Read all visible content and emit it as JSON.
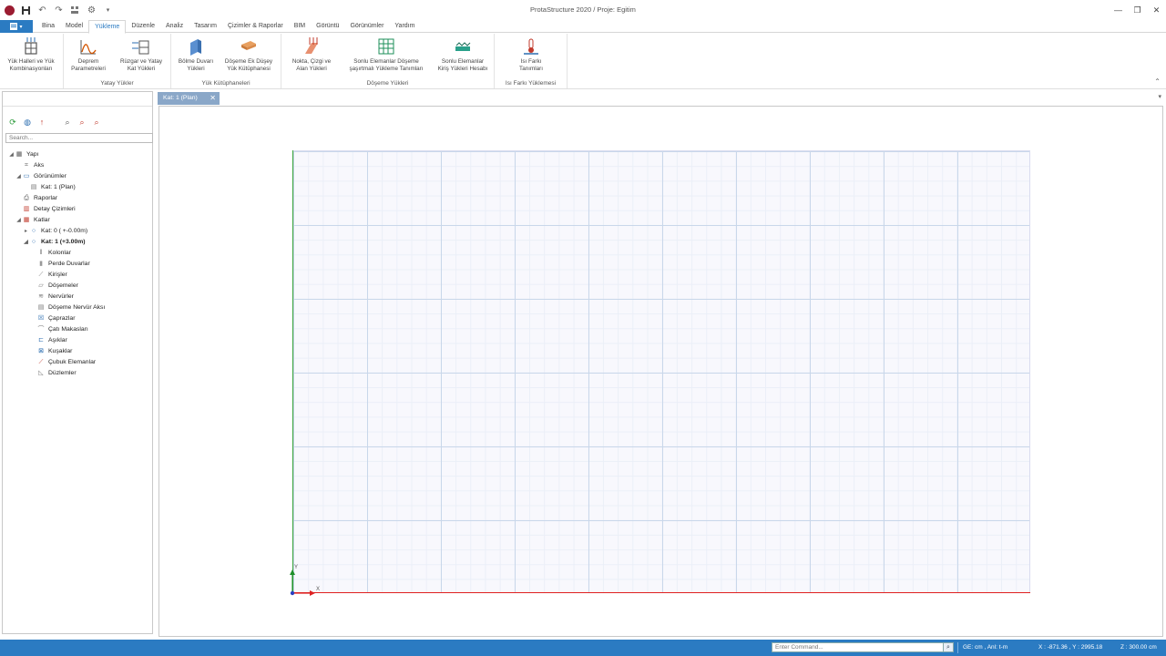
{
  "window": {
    "title": "ProtaStructure 2020 / Proje: Egitim"
  },
  "tabs": [
    {
      "label": "Bina",
      "active": false
    },
    {
      "label": "Model",
      "active": false
    },
    {
      "label": "Yükleme",
      "active": true
    },
    {
      "label": "Düzenle",
      "active": false
    },
    {
      "label": "Analiz",
      "active": false
    },
    {
      "label": "Tasarım",
      "active": false
    },
    {
      "label": "Çizimler & Raporlar",
      "active": false
    },
    {
      "label": "BIM",
      "active": false
    },
    {
      "label": "Görüntü",
      "active": false
    },
    {
      "label": "Görünümler",
      "active": false
    },
    {
      "label": "Yardım",
      "active": false
    }
  ],
  "ribbon": {
    "groups": [
      {
        "title": "",
        "buttons": [
          {
            "line1": "Yük Halleri ve Yük",
            "line2": "Kombinasyonları",
            "icon": "load-cases-icon"
          }
        ]
      },
      {
        "title": "Yatay Yükler",
        "buttons": [
          {
            "line1": "Deprem",
            "line2": "Parametreleri",
            "icon": "seismic-icon"
          },
          {
            "line1": "Rüzgar ve Yatay",
            "line2": "Kat Yükleri",
            "icon": "wind-icon"
          }
        ]
      },
      {
        "title": "Yük Kütüphaneleri",
        "buttons": [
          {
            "line1": "Bölme Duvarı",
            "line2": "Yükleri",
            "icon": "partition-wall-icon"
          },
          {
            "line1": "Döşeme Ek Düşey",
            "line2": "Yük Kütüphanesi",
            "icon": "slab-library-icon"
          }
        ]
      },
      {
        "title": "Döşeme Yükleri",
        "buttons": [
          {
            "line1": "Nokta, Çizgi ve",
            "line2": "Alan Yükleri",
            "icon": "point-line-area-icon"
          },
          {
            "line1": "Sonlu Elemanlar Döşeme",
            "line2": "şaşırtmalı Yükleme Tanımları",
            "icon": "fe-slab-icon"
          },
          {
            "line1": "Sonlu Elemanlar",
            "line2": "Kiriş Yükleri Hesabı",
            "icon": "fe-beam-icon"
          }
        ]
      },
      {
        "title": "Isı Farkı Yüklemesi",
        "buttons": [
          {
            "line1": "Isı Farkı",
            "line2": "Tanımları",
            "icon": "temperature-icon"
          }
        ]
      }
    ]
  },
  "left_panel": {
    "search_placeholder": "Search...",
    "tree": [
      {
        "label": "Yapı",
        "level": 0,
        "exp": "◢",
        "icon": "building-icon",
        "bold": false
      },
      {
        "label": "Aks",
        "level": 1,
        "exp": "",
        "icon": "axis-icon",
        "bold": false
      },
      {
        "label": "Görünümler",
        "level": 1,
        "exp": "◢",
        "icon": "views-icon",
        "bold": false
      },
      {
        "label": "Kat: 1 (Plan)",
        "level": 2,
        "exp": "",
        "icon": "plan-view-icon",
        "bold": false
      },
      {
        "label": "Raporlar",
        "level": 1,
        "exp": "",
        "icon": "printer-icon",
        "bold": false
      },
      {
        "label": "Detay Çizimleri",
        "level": 1,
        "exp": "",
        "icon": "drawings-icon",
        "bold": false
      },
      {
        "label": "Katlar",
        "level": 1,
        "exp": "◢",
        "icon": "storeys-icon",
        "bold": false
      },
      {
        "label": "Kat: 0 ( +-0.00m)",
        "level": 2,
        "exp": "▸",
        "icon": "storey-icon",
        "bold": false
      },
      {
        "label": "Kat: 1 (+3.00m)",
        "level": 2,
        "exp": "◢",
        "icon": "storey-icon",
        "bold": true
      },
      {
        "label": "Kolonlar",
        "level": 3,
        "exp": "",
        "icon": "column-icon",
        "bold": false
      },
      {
        "label": "Perde Duvarlar",
        "level": 3,
        "exp": "",
        "icon": "shear-wall-icon",
        "bold": false
      },
      {
        "label": "Kirişler",
        "level": 3,
        "exp": "",
        "icon": "beam-icon",
        "bold": false
      },
      {
        "label": "Döşemeler",
        "level": 3,
        "exp": "",
        "icon": "slab-icon",
        "bold": false
      },
      {
        "label": "Nervürler",
        "level": 3,
        "exp": "",
        "icon": "rib-icon",
        "bold": false
      },
      {
        "label": "Döşeme Nervür Aksı",
        "level": 3,
        "exp": "",
        "icon": "rib-axis-icon",
        "bold": false
      },
      {
        "label": "Çaprazlar",
        "level": 3,
        "exp": "",
        "icon": "brace-icon",
        "bold": false
      },
      {
        "label": "Çatı Makasları",
        "level": 3,
        "exp": "",
        "icon": "truss-icon",
        "bold": false
      },
      {
        "label": "Aşıklar",
        "level": 3,
        "exp": "",
        "icon": "purlin-icon",
        "bold": false
      },
      {
        "label": "Kuşaklar",
        "level": 3,
        "exp": "",
        "icon": "girt-icon",
        "bold": false
      },
      {
        "label": "Çubuk Elemanlar",
        "level": 3,
        "exp": "",
        "icon": "bar-element-icon",
        "bold": false
      },
      {
        "label": "Düzlemler",
        "level": 3,
        "exp": "",
        "icon": "plane-icon",
        "bold": false
      }
    ]
  },
  "doc_tab": {
    "label": "Kat: 1 (Plan)",
    "close": "✕"
  },
  "axis": {
    "x_label": "X",
    "y_label": "Y"
  },
  "status": {
    "command_placeholder": "Enter Command...",
    "units": "GE: cm , Anl: t-m",
    "coords": "X : -871.36 , Y : 2995.18",
    "z": "Z : 300.00 cm"
  }
}
